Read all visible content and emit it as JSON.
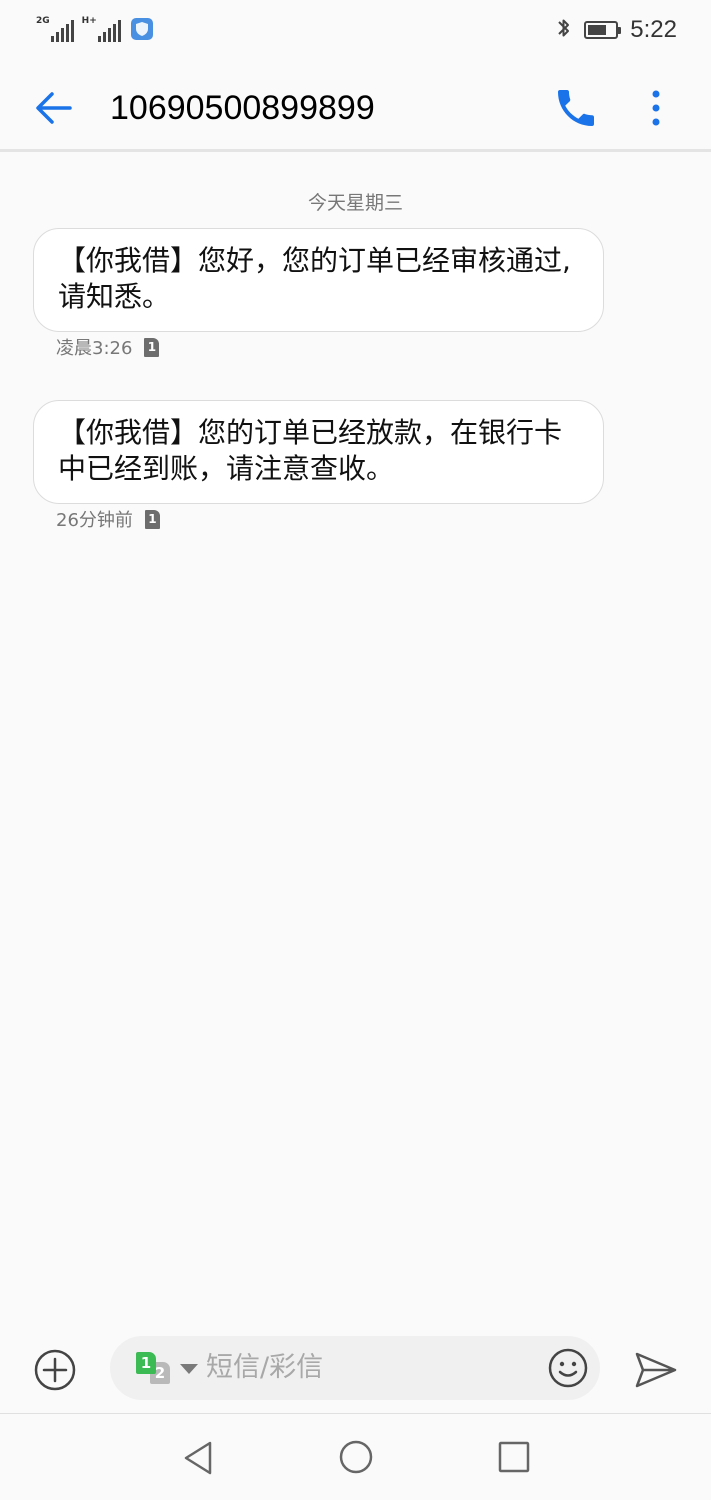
{
  "status_bar": {
    "sim1_network": "2G",
    "sim2_network": "H+",
    "time": "5:22",
    "battery_level": 0.7
  },
  "header": {
    "title": "10690500899899",
    "back_icon": "arrow-left-icon",
    "call_icon": "phone-icon",
    "more_icon": "more-vertical-icon"
  },
  "conversation": {
    "date_separator": "今天星期三",
    "messages": [
      {
        "text": "【你我借】您好，您的订单已经审核通过,请知悉。",
        "time": "凌晨3:26",
        "sim": "1"
      },
      {
        "text": "【你我借】您的订单已经放款，在银行卡中已经到账，请注意查收。",
        "time": "26分钟前",
        "sim": "1"
      }
    ]
  },
  "composer": {
    "placeholder": "短信/彩信",
    "sim_primary": "1",
    "sim_secondary": "2"
  },
  "colors": {
    "accent": "#1a73e8",
    "sim1_green": "#3cba54",
    "bubble_bg": "#ffffff",
    "page_bg": "#fafafa"
  }
}
